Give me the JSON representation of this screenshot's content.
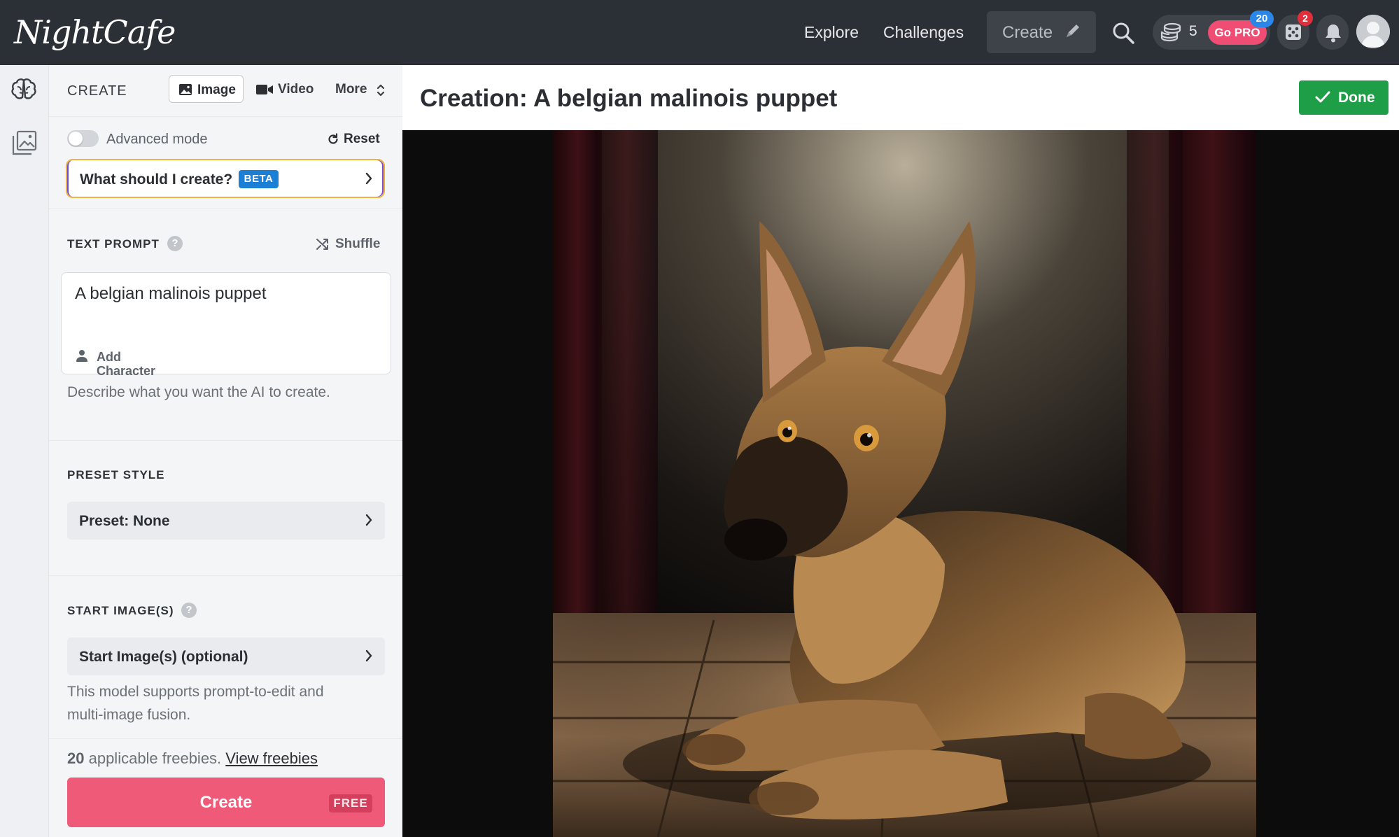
{
  "brand": {
    "name": "NightCafe"
  },
  "topnav": {
    "explore": "Explore",
    "challenges": "Challenges",
    "create": "Create",
    "credits": "5",
    "gopro": "Go PRO",
    "gopro_badge": "20",
    "dice_badge": "2"
  },
  "panel": {
    "title": "CREATE",
    "tabs": {
      "image": "Image",
      "video": "Video",
      "more": "More"
    },
    "advanced_mode": "Advanced mode",
    "reset": "Reset",
    "what_should_i_create": "What should I create?",
    "beta": "BETA",
    "text_prompt": {
      "title": "TEXT PROMPT",
      "help": "?",
      "shuffle": "Shuffle",
      "value": "A belgian malinois puppet",
      "add_character": "Add Character",
      "hint": "Describe what you want the AI to create."
    },
    "preset_style": {
      "title": "PRESET STYLE",
      "value": "Preset: None"
    },
    "start_images": {
      "title": "START IMAGE(S)",
      "help": "?",
      "value": "Start Image(s) (optional)",
      "hint_line1": "This model supports prompt-to-edit and",
      "hint_line2": "multi-image fusion."
    },
    "freebies": {
      "count": "20",
      "text": " applicable freebies. ",
      "link": "View freebies"
    },
    "create_button": {
      "label": "Create",
      "badge": "FREE"
    }
  },
  "main": {
    "title": "Creation: A belgian malinois puppet",
    "done": "Done"
  },
  "colors": {
    "topbar": "#2b2f36",
    "accent_pink": "#ef5a78",
    "done_green": "#1f9e48",
    "beta_blue": "#1c7fd6"
  },
  "icons": [
    "brain-icon",
    "gallery-icon",
    "image-icon",
    "video-icon",
    "chevron-updown-icon",
    "reset-icon",
    "chevron-right-icon",
    "shuffle-icon",
    "person-icon",
    "search-icon",
    "coins-icon",
    "dice-icon",
    "bell-icon",
    "pen-icon",
    "check-icon"
  ]
}
